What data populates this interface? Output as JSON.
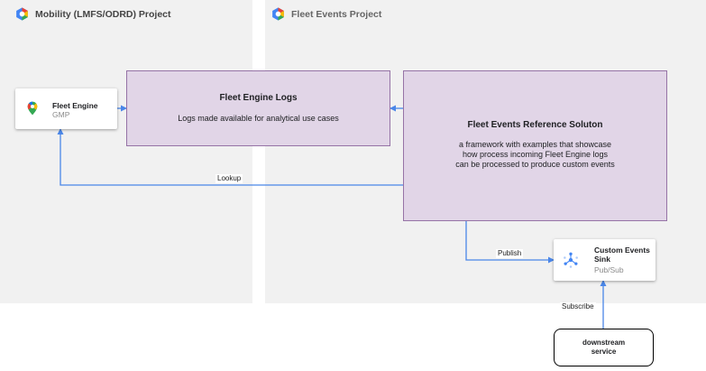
{
  "projects": {
    "mobility": {
      "title": "Mobility (LMFS/ODRD) Project"
    },
    "fleet_events": {
      "title": "Fleet Events Project"
    }
  },
  "fleet_engine": {
    "title": "Fleet Engine",
    "subtitle": "GMP"
  },
  "fleet_engine_logs": {
    "title": "Fleet Engine Logs",
    "description": "Logs made available for analytical use cases"
  },
  "reference_solution": {
    "title": "Fleet Events Reference Soluton",
    "description_lines": [
      "a framework with examples that showcase",
      "how process incoming Fleet Engine logs",
      "can be processed to produce custom events"
    ]
  },
  "custom_events_sink": {
    "title_lines": [
      "Custom Events",
      "Sink"
    ],
    "subtitle": "Pub/Sub"
  },
  "downstream": {
    "lines": [
      "downstream",
      "service"
    ]
  },
  "edges": {
    "lookup": "Lookup",
    "publish": "Publish",
    "subscribe": "Subscribe"
  },
  "colors": {
    "arrow": "#4a86e8",
    "box_fill": "#e1d5e7",
    "box_border": "#9673a6",
    "region": "#f1f1f1"
  },
  "icons": [
    "google-cloud-icon",
    "maps-pin-icon",
    "pubsub-icon"
  ]
}
